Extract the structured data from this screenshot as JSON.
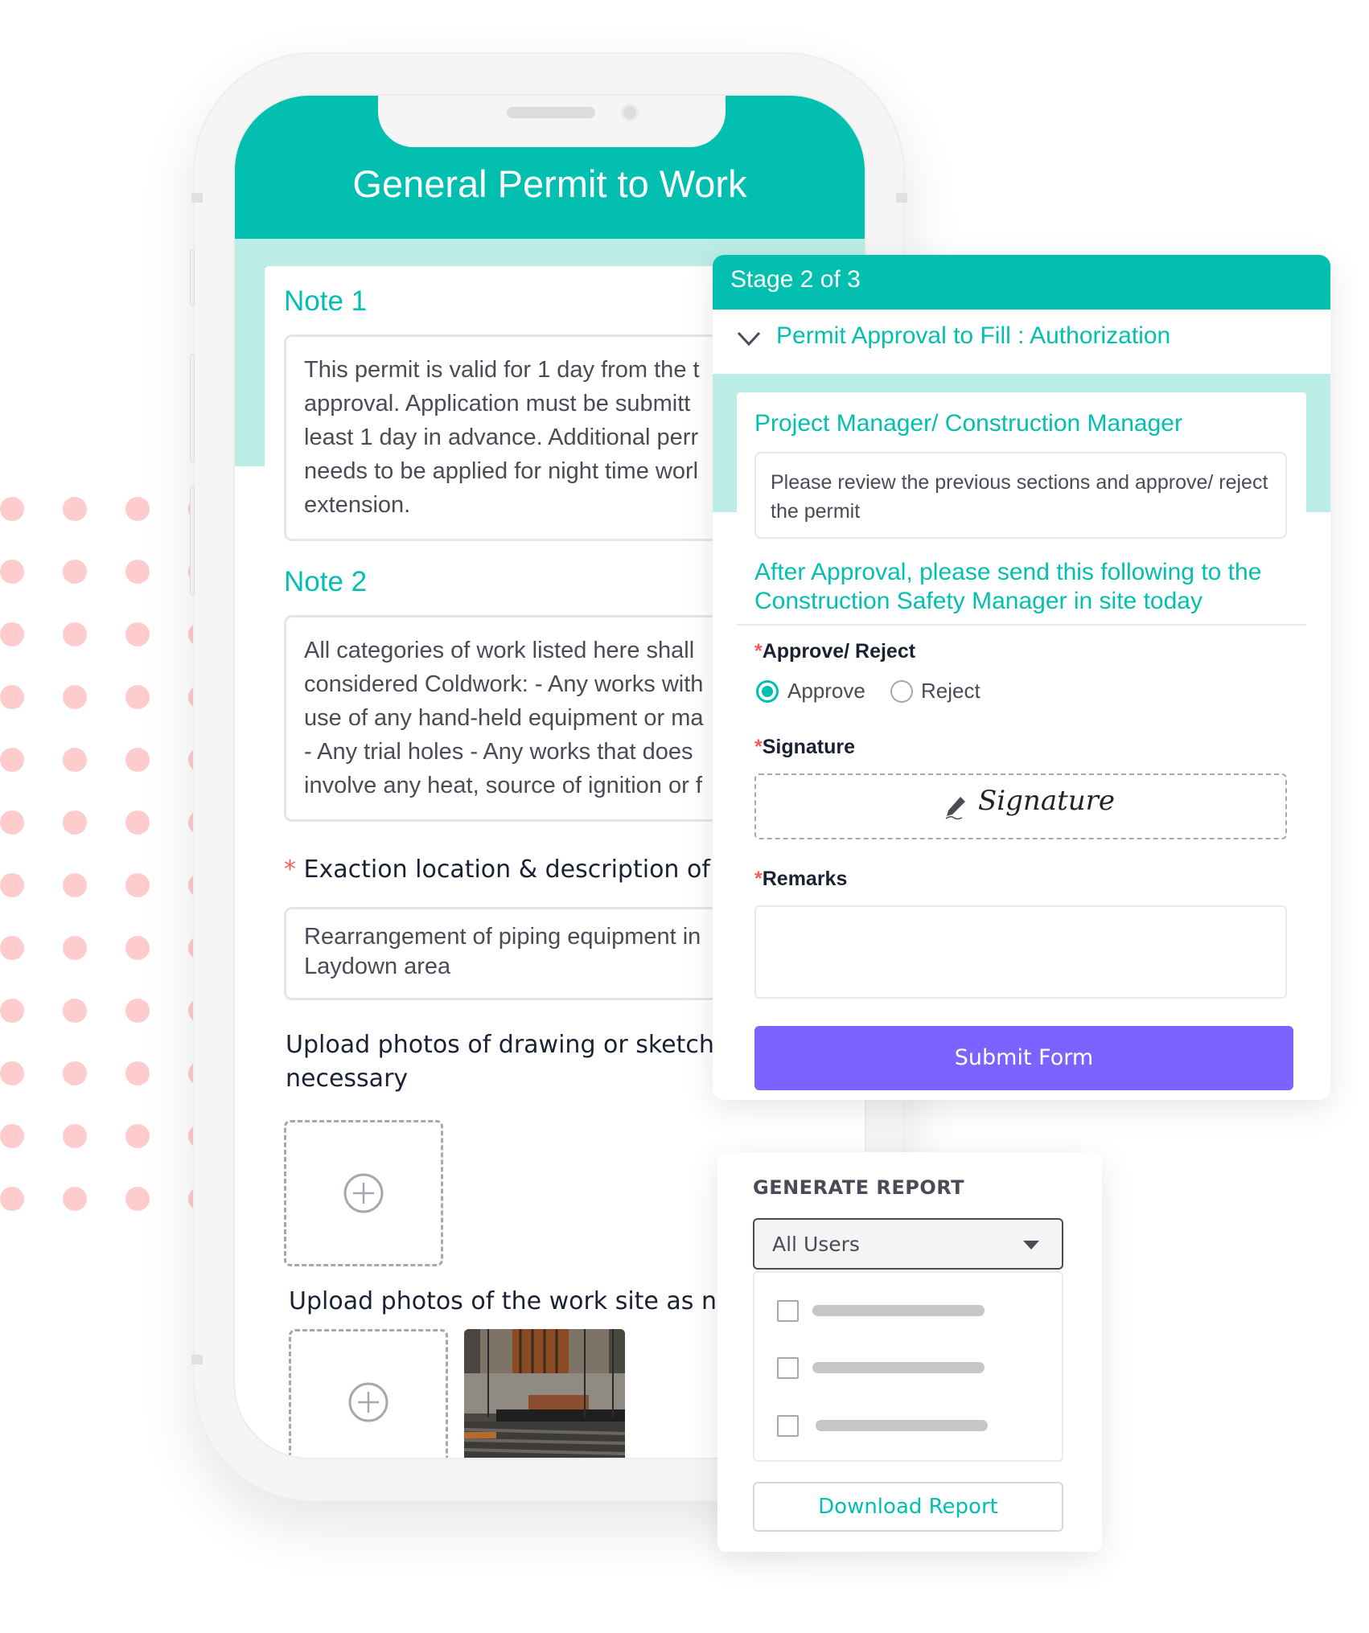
{
  "phone": {
    "title": "General Permit to Work",
    "note1": {
      "title": "Note 1",
      "lines": [
        "This permit is valid for 1 day from the t",
        "approval. Application must be submitt",
        "least 1 day in advance. Additional perr",
        "needs to be applied for night time worl",
        "extension."
      ]
    },
    "note2": {
      "title": "Note 2",
      "lines": [
        "All categories of work listed here shall",
        "considered Coldwork: - Any works with",
        "use of any hand-held equipment or ma",
        "-  Any trial holes -  Any works that does",
        "involve any heat, source of ignition or f"
      ]
    },
    "location_field": {
      "required_mark": "*",
      "label": "Exaction location & description of w",
      "value_lines": [
        "Rearrangement of piping equipment in",
        "Laydown area"
      ]
    },
    "upload_drawings": {
      "label_lines": [
        "Upload photos of drawing or sketche",
        "necessary"
      ]
    },
    "upload_site": {
      "label": "Upload photos of the work site as ne"
    }
  },
  "stage": {
    "header": "Stage 2 of 3",
    "section_title": "Permit Approval to Fill : Authorization",
    "role_title": "Project Manager/ Construction Manager",
    "instruction": "Please review the previous sections and approve/ reject the permit",
    "after_approval": "After Approval, please send this following to the Construction Safety Manager in site today",
    "approve_reject": {
      "required_mark": "*",
      "label": "Approve/ Reject",
      "options": [
        {
          "label": "Approve",
          "checked": true
        },
        {
          "label": "Reject",
          "checked": false
        }
      ]
    },
    "signature": {
      "required_mark": "*",
      "label": "Signature",
      "placeholder": "Signature"
    },
    "remarks": {
      "required_mark": "*",
      "label": "Remarks",
      "value": ""
    },
    "submit_label": "Submit Form"
  },
  "report": {
    "title": "GENERATE REPORT",
    "select_value": "All Users",
    "options_count": 3,
    "download_label": "Download Report"
  },
  "colors": {
    "primary": "#02bfb0",
    "primary_light": "#bcece6",
    "submit": "#7b63ff",
    "required": "#f25c5c",
    "dots": "#ffcccd"
  }
}
